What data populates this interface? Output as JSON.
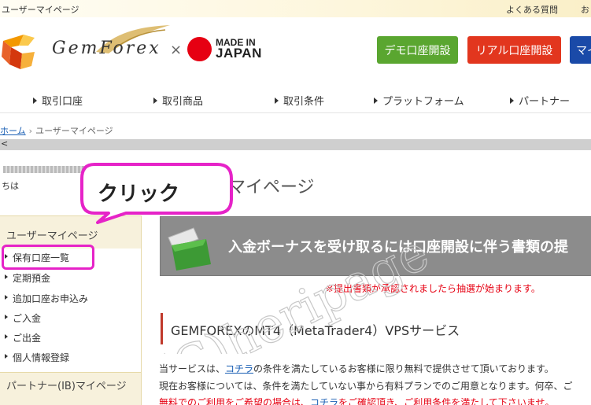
{
  "topbar": {
    "title": "ユーザーマイページ",
    "faq": "よくある質問",
    "more": "お"
  },
  "logo": {
    "brand": "GemForex",
    "times": "×",
    "made_in": "MADE IN",
    "japan": "JAPAN"
  },
  "buttons": {
    "demo": "デモ口座開設",
    "real": "リアル口座開設",
    "my": "マイ"
  },
  "nav": [
    "取引口座",
    "取引商品",
    "取引条件",
    "プラットフォーム",
    "パートナー"
  ],
  "breadcrumb": {
    "home": "ホーム",
    "separator": "›",
    "current": "ユーザーマイページ"
  },
  "greybar": {
    "arrow": "<"
  },
  "user": {
    "suffix": "ちは"
  },
  "page_title": "マイページ",
  "sidebar": {
    "header": "ユーザーマイページ",
    "items": [
      "保有口座一覧",
      "定期預金",
      "追加口座お申込み",
      "ご入金",
      "ご出金",
      "個人情報登録"
    ],
    "footer": "パートナー(IB)マイページ"
  },
  "callout": {
    "label": "クリック"
  },
  "banner": {
    "text": "入金ボーナスを受け取るには口座開設に伴う書類の提"
  },
  "notice": "※提出書類が承認されましたら抽選が始まります。",
  "vps": {
    "title": "GEMFOREXのMT4（MetaTrader4）VPSサービス",
    "line1_prefix": "当サービスは、",
    "line1_link": "コチラ",
    "line1_suffix": "の条件を満たしているお客様に限り無料で提供させて頂いております。",
    "line2": "現在お客様については、条件を満たしていない事から有料プランでのご用意となります。何卒、ご",
    "line3_prefix": "無料でのご利用をご希望の場合は、",
    "line3_link": "コチラ",
    "line3_suffix": "をご確認頂き、ご利用条件を満たして下さいませ。"
  },
  "watermark": "(C)heripage",
  "colors": {
    "green": "#5aa630",
    "red": "#e2361e",
    "blue": "#1a4aa8",
    "magenta": "#e623c8",
    "notice_red": "#e60012"
  }
}
